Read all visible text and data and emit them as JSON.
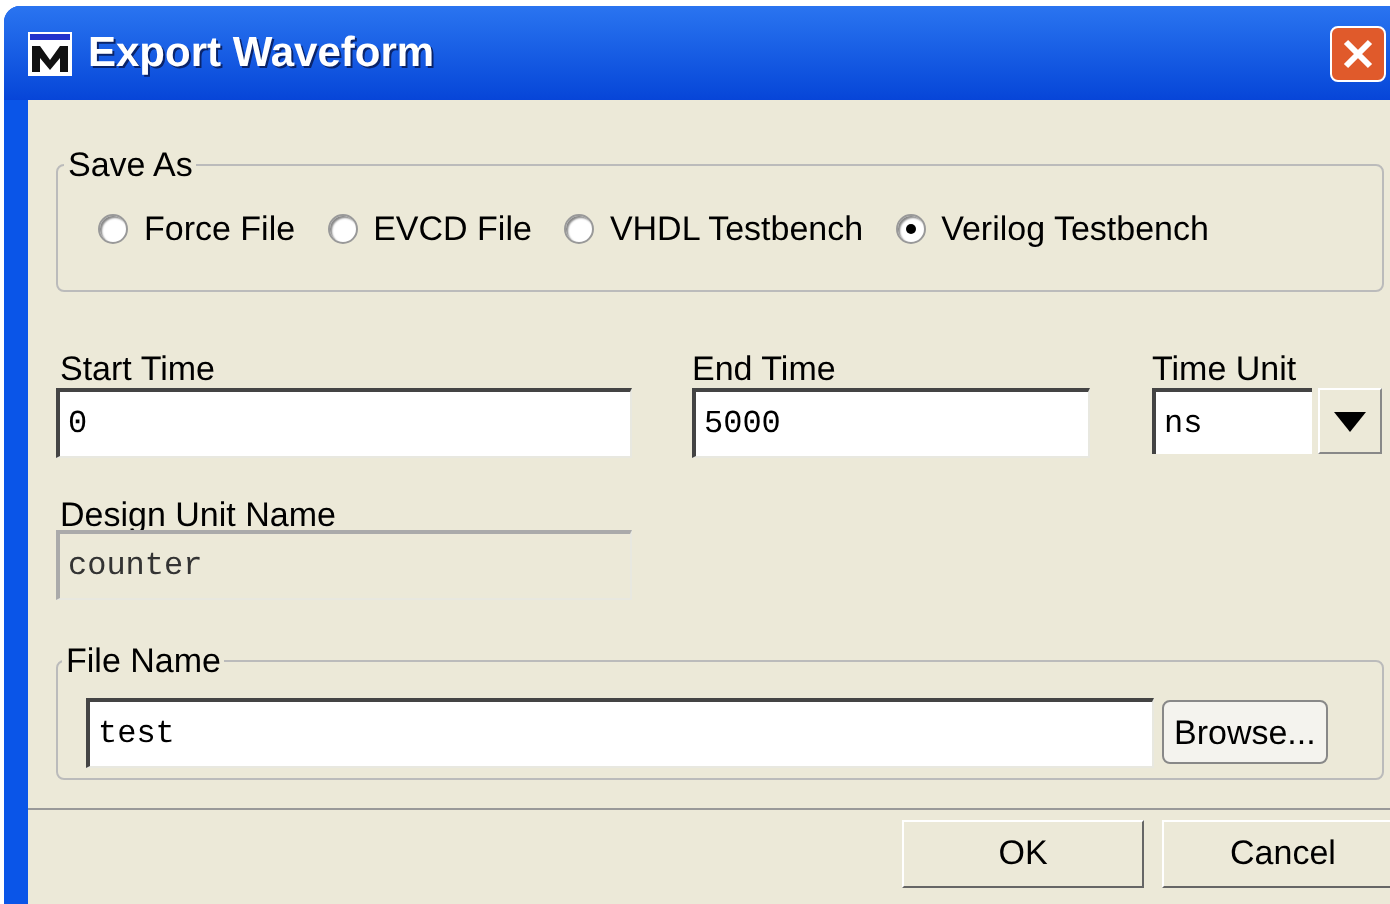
{
  "window": {
    "title": "Export Waveform"
  },
  "save_as": {
    "label": "Save As",
    "options": [
      {
        "label": "Force File",
        "selected": false
      },
      {
        "label": "EVCD File",
        "selected": false
      },
      {
        "label": "VHDL Testbench",
        "selected": false
      },
      {
        "label": "Verilog Testbench",
        "selected": true
      }
    ]
  },
  "start_time": {
    "label": "Start Time",
    "value": "0"
  },
  "end_time": {
    "label": "End Time",
    "value": "5000"
  },
  "time_unit": {
    "label": "Time Unit",
    "value": "ns"
  },
  "design_unit_name": {
    "label": "Design Unit Name",
    "value": "counter",
    "disabled": true
  },
  "file_name": {
    "label": "File Name",
    "value": "test",
    "browse": "Browse..."
  },
  "buttons": [
    "OK",
    "Cancel"
  ]
}
